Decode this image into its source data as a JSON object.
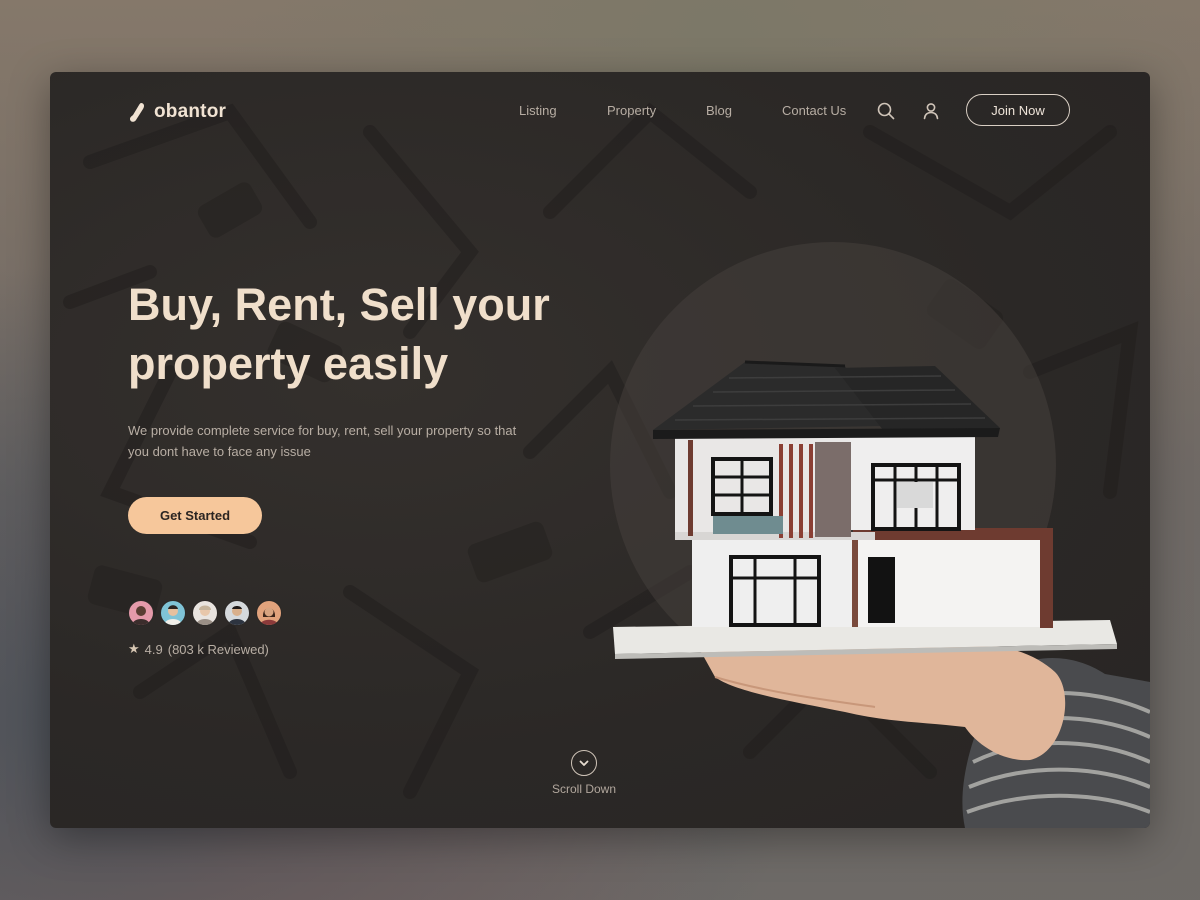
{
  "brand": {
    "name": "obantor",
    "icon": "logo-mark-icon"
  },
  "nav": {
    "items": [
      {
        "label": "Listing"
      },
      {
        "label": "Property"
      },
      {
        "label": "Blog"
      },
      {
        "label": "Contact Us"
      }
    ],
    "search_icon": "search-icon",
    "user_icon": "user-icon",
    "join_label": "Join Now"
  },
  "hero": {
    "headline_line1": "Buy, Rent, Sell your",
    "headline_line2": "property easily",
    "subtext": "We provide complete service for buy, rent, sell your property so that you dont have to face any issue",
    "cta_label": "Get Started",
    "rating_value": "4.9",
    "rating_text": "(803 k Reviewed)",
    "rating_icon": "star-icon"
  },
  "scroll": {
    "label": "Scroll Down",
    "icon": "chevron-down-icon"
  },
  "colors": {
    "accent": "#f6c79b",
    "headline": "#f0dfcb",
    "background": "#2b2826"
  }
}
